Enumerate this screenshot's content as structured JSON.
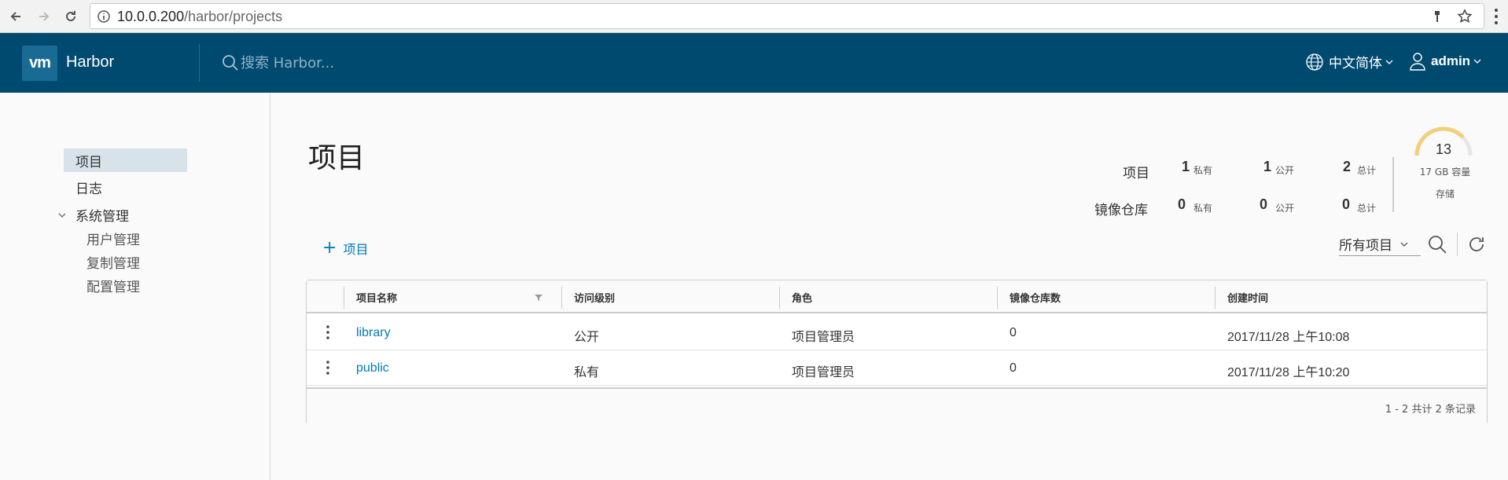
{
  "browser": {
    "url_host": "10.0.0.200",
    "url_path": "/harbor/projects"
  },
  "header": {
    "logo_text": "vm",
    "brand": "Harbor",
    "search_placeholder": "搜索 Harbor...",
    "language": "中文简体",
    "user": "admin"
  },
  "sidebar": {
    "projects": "项目",
    "logs": "日志",
    "admin": "系统管理",
    "users": "用户管理",
    "replication": "复制管理",
    "config": "配置管理"
  },
  "main": {
    "title": "项目",
    "stats": {
      "projects_label": "项目",
      "repos_label": "镜像仓库",
      "private_label": "私有",
      "public_label": "公开",
      "total_label": "总计",
      "projects_private": "1",
      "projects_public": "1",
      "projects_total": "2",
      "repos_private": "0",
      "repos_public": "0",
      "repos_total": "0"
    },
    "storage": {
      "used": "13",
      "capacity": "17 GB 容量",
      "label": "存储",
      "used_fraction": 0.76
    },
    "add_label": "项目",
    "filter": "所有项目"
  },
  "table": {
    "headers": {
      "name": "项目名称",
      "access": "访问级别",
      "role": "角色",
      "repos": "镜像仓库数",
      "created": "创建时间"
    },
    "rows": [
      {
        "name": "library",
        "access": "公开",
        "role": "项目管理员",
        "repos": "0",
        "created": "2017/11/28 上午10:08"
      },
      {
        "name": "public",
        "access": "私有",
        "role": "项目管理员",
        "repos": "0",
        "created": "2017/11/28 上午10:20"
      }
    ],
    "footer": "1 - 2 共计 2 条记录"
  },
  "colors": {
    "header_bg": "#004a70",
    "link": "#0079b8",
    "gauge": "#f3cf7a"
  }
}
